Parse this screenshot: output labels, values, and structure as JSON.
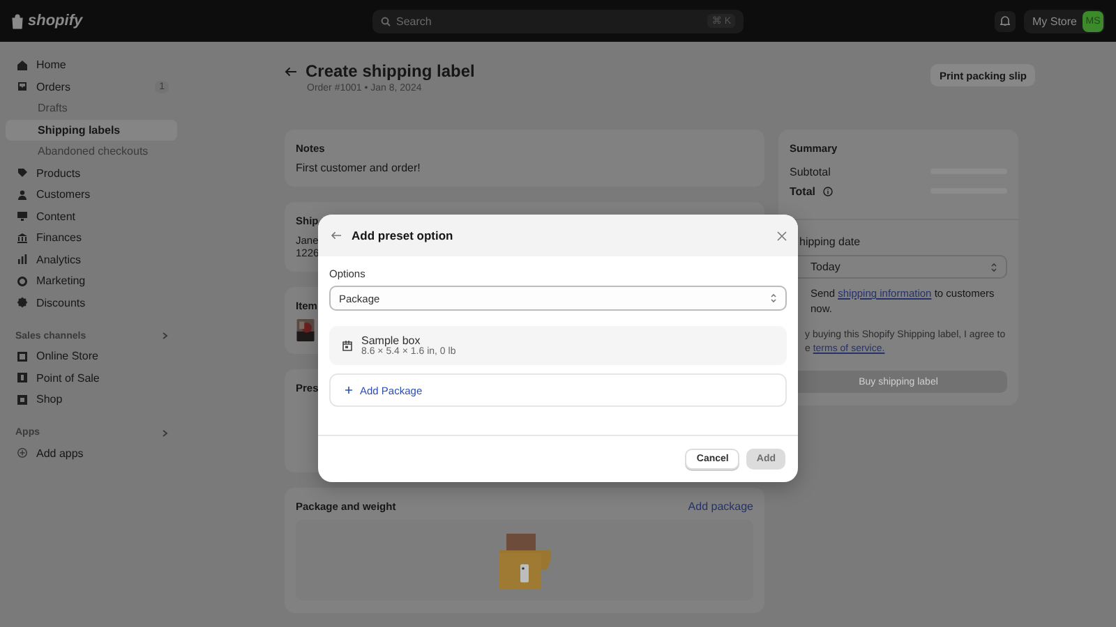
{
  "topbar": {
    "brand": "shopify",
    "search": {
      "placeholder": "Search",
      "shortcut": "⌘ K"
    },
    "store": "My Store",
    "avatar": "MS"
  },
  "sidebar": {
    "items": [
      {
        "label": "Home",
        "selected": false
      },
      {
        "label": "Orders",
        "badge": "1",
        "selected": false,
        "children": [
          {
            "label": "Drafts",
            "selected": false
          },
          {
            "label": "Shipping labels",
            "selected": true
          },
          {
            "label": "Abandoned checkouts",
            "selected": false
          }
        ]
      },
      {
        "label": "Products",
        "selected": false
      },
      {
        "label": "Customers",
        "selected": false
      },
      {
        "label": "Content",
        "selected": false
      },
      {
        "label": "Finances",
        "selected": false
      },
      {
        "label": "Analytics",
        "selected": false
      },
      {
        "label": "Marketing",
        "selected": false
      },
      {
        "label": "Discounts",
        "selected": false
      }
    ],
    "sections": [
      {
        "title": "Sales channels",
        "items": [
          {
            "label": "Online Store",
            "selected": false
          },
          {
            "label": "Point of Sale",
            "selected": false
          },
          {
            "label": "Shop",
            "selected": false
          }
        ]
      },
      {
        "title": "Apps",
        "items": [
          {
            "label": "Add apps",
            "selected": false
          }
        ]
      }
    ]
  },
  "page": {
    "title": "Create shipping label",
    "subtitle": "Order #1001 • Jan 8, 2024",
    "action": "Print packing slip"
  },
  "notes": {
    "title": "Notes",
    "text": "First customer and order!"
  },
  "shipping": {
    "title": "Ship",
    "lines": [
      "Jane",
      "1226"
    ]
  },
  "items": {
    "title": "Item"
  },
  "preset": {
    "title": "Pres"
  },
  "package": {
    "title": "Package and weight",
    "action": "Add package"
  },
  "summary": {
    "title": "Summary",
    "rows": [
      {
        "label": "Subtotal",
        "strong": false,
        "info": false
      },
      {
        "label": "Total",
        "strong": true,
        "info": true
      }
    ],
    "date_label": "hipping date",
    "date_value": "Today",
    "notify": {
      "before": "Send ",
      "link": "shipping information",
      "after": " to customers now."
    },
    "terms": {
      "line1": "y buying this Shopify Shipping label, I agree to",
      "before": "e ",
      "link": "terms of service."
    },
    "buy": {
      "label": "Buy shipping label",
      "disabled": true
    }
  },
  "modal": {
    "title": "Add preset option",
    "options_label": "Options",
    "select_value": "Package",
    "presets": [
      {
        "name": "Sample box",
        "dims": "8.6 × 5.4 × 1.6 in, 0 lb"
      }
    ],
    "add_link": "Add Package",
    "buttons": [
      {
        "label": "Cancel",
        "primary": false,
        "disabled": false
      },
      {
        "label": "Add",
        "primary": true,
        "disabled": true
      }
    ]
  }
}
